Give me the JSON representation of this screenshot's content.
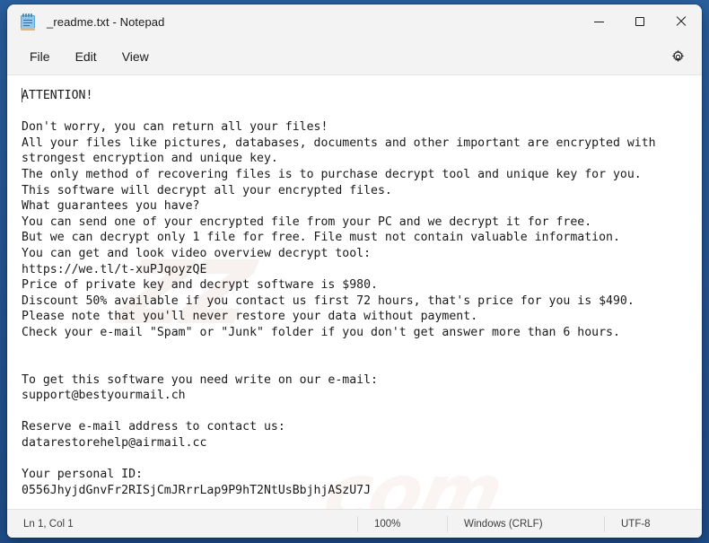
{
  "window": {
    "title": "_readme.txt - Notepad",
    "app_icon": "notepad-icon",
    "controls": {
      "minimize": "minimize-icon",
      "maximize": "maximize-icon",
      "close": "close-icon"
    }
  },
  "menubar": {
    "items": [
      {
        "label": "File"
      },
      {
        "label": "Edit"
      },
      {
        "label": "View"
      }
    ],
    "settings_icon": "gear-icon"
  },
  "document": {
    "filename": "_readme.txt",
    "content": "ATTENTION!\n\nDon't worry, you can return all your files!\nAll your files like pictures, databases, documents and other important are encrypted with\nstrongest encryption and unique key.\nThe only method of recovering files is to purchase decrypt tool and unique key for you.\nThis software will decrypt all your encrypted files.\nWhat guarantees you have?\nYou can send one of your encrypted file from your PC and we decrypt it for free.\nBut we can decrypt only 1 file for free. File must not contain valuable information.\nYou can get and look video overview decrypt tool:\nhttps://we.tl/t-xuPJqoyzQE\nPrice of private key and decrypt software is $980.\nDiscount 50% available if you contact us first 72 hours, that's price for you is $490.\nPlease note that you'll never restore your data without payment.\nCheck your e-mail \"Spam\" or \"Junk\" folder if you don't get answer more than 6 hours.\n\n\nTo get this software you need write on our e-mail:\nsupport@bestyourmail.ch\n\nReserve e-mail address to contact us:\ndatarestorehelp@airmail.cc\n\nYour personal ID:\n0556JhyjdGnvFr2RISjCmJRrrLap9P9hT2NtUsBbjhjASzU7J",
    "lines": [
      "ATTENTION!",
      "",
      "Don't worry, you can return all your files!",
      "All your files like pictures, databases, documents and other important are encrypted with",
      "strongest encryption and unique key.",
      "The only method of recovering files is to purchase decrypt tool and unique key for you.",
      "This software will decrypt all your encrypted files.",
      "What guarantees you have?",
      "You can send one of your encrypted file from your PC and we decrypt it for free.",
      "But we can decrypt only 1 file for free. File must not contain valuable information.",
      "You can get and look video overview decrypt tool:",
      "https://we.tl/t-xuPJqoyzQE",
      "Price of private key and decrypt software is $980.",
      "Discount 50% available if you contact us first 72 hours, that's price for you is $490.",
      "Please note that you'll never restore your data without payment.",
      "Check your e-mail \"Spam\" or \"Junk\" folder if you don't get answer more than 6 hours.",
      "",
      "",
      "To get this software you need write on our e-mail:",
      "support@bestyourmail.ch",
      "",
      "Reserve e-mail address to contact us:",
      "datarestorehelp@airmail.cc",
      "",
      "Your personal ID:",
      "0556JhyjdGnvFr2RISjCmJRrrLap9P9hT2NtUsBbjhjASzU7J"
    ],
    "video_url": "https://we.tl/t-xuPJqoyzQE",
    "price_full": "$980",
    "price_discount": "$490",
    "discount_percent": "50%",
    "discount_window_hours": "72 hours",
    "reply_window_hours": "6 hours",
    "email_primary": "support@bestyourmail.ch",
    "email_reserve": "datarestorehelp@airmail.cc",
    "personal_id": "0556JhyjdGnvFr2RISjCmJRrrLap9P9hT2NtUsBbjhjASzU7J"
  },
  "watermark": {
    "upper": "zz",
    "lower": "com"
  },
  "statusbar": {
    "position": "Ln 1, Col 1",
    "zoom": "100%",
    "line_ending": "Windows (CRLF)",
    "encoding": "UTF-8"
  },
  "colors": {
    "desktop": "#1f4e8c",
    "chrome": "#f3f3f3",
    "editor_bg": "#ffffff",
    "text": "#1a1a1a",
    "close_hover": "#c42b1c"
  }
}
